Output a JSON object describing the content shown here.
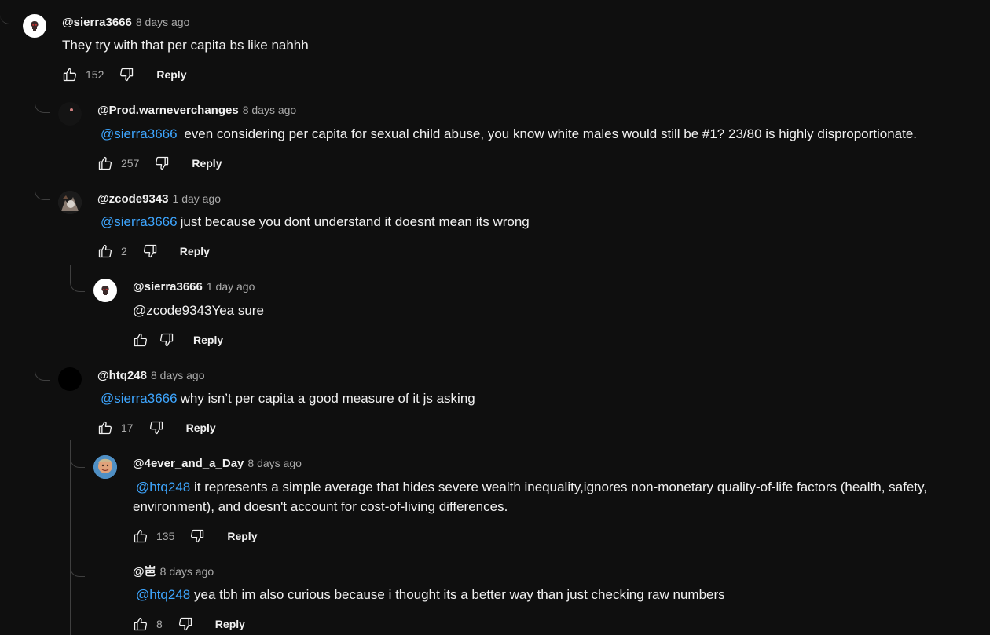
{
  "comments": [
    {
      "author": "@sierra3666",
      "time": "8 days ago",
      "text": "They try with that per capita bs like nahhh",
      "likes": "152",
      "reply_label": "Reply",
      "avatar_icon": "skull-logo-avatar"
    },
    {
      "author": "@Prod.warneverchanges",
      "time": "8 days ago",
      "mention": "@sierra3666",
      "text": " even considering per capita for sexual child abuse, you know white males would still be #1? 23/80 is highly disproportionate.",
      "likes": "257",
      "reply_label": "Reply",
      "avatar_icon": "dark-dot-avatar"
    },
    {
      "author": "@zcode9343",
      "time": "1 day ago",
      "mention": "@sierra3666",
      "text": "just because you dont understand it doesnt mean its wrong",
      "likes": "2",
      "reply_label": "Reply",
      "avatar_icon": "photo-avatar"
    },
    {
      "author": "@sierra3666",
      "time": "1 day ago",
      "text": "@zcode9343Yea sure",
      "likes": "",
      "reply_label": "Reply",
      "avatar_icon": "skull-logo-avatar"
    },
    {
      "author": "@htq248",
      "time": "8 days ago",
      "mention": "@sierra3666",
      "text": "why isn’t per capita a good measure of it js asking",
      "likes": "17",
      "reply_label": "Reply",
      "avatar_icon": "black-avatar"
    },
    {
      "author": "@4ever_and_a_Day",
      "time": "8 days ago",
      "mention": "@htq248",
      "text": "it represents a simple average that hides severe wealth inequality,ignores non-monetary quality-of-life factors (health, safety, environment), and doesn't account for cost-of-living differences.",
      "likes": "135",
      "reply_label": "Reply",
      "avatar_icon": "face-photo-avatar"
    },
    {
      "author": "@岜",
      "time": "8 days ago",
      "mention": "@htq248",
      "text": "yea tbh im also curious because i thought its a better way than just checking raw numbers",
      "likes": "8",
      "reply_label": "Reply",
      "avatar_icon": "none"
    }
  ],
  "colors": {
    "background": "#0f0f0f",
    "mention": "#3ea6ff",
    "muted": "#aaaaaa",
    "text": "#f1f1f1",
    "thread_line": "#3f3f3f"
  },
  "icons": {
    "like": "thumbs-up-icon",
    "dislike": "thumbs-down-icon"
  }
}
